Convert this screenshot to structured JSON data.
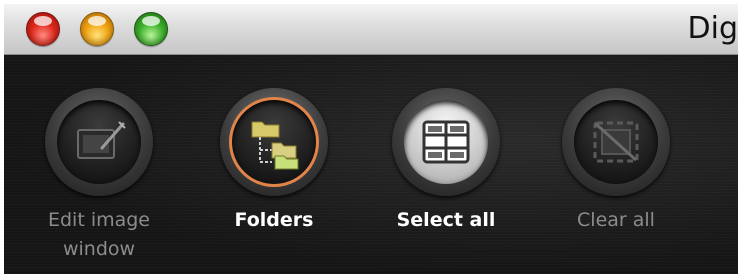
{
  "window": {
    "title": "Dig",
    "traffic_lights": [
      "close",
      "minimize",
      "zoom"
    ]
  },
  "toolbar": {
    "items": [
      {
        "label": "Edit image window",
        "icon": "edit-image-icon",
        "enabled": false
      },
      {
        "label": "Folders",
        "icon": "folders-icon",
        "enabled": true,
        "active": true
      },
      {
        "label": "Select all",
        "icon": "select-all-icon",
        "enabled": true
      },
      {
        "label": "Clear all",
        "icon": "clear-all-icon",
        "enabled": false
      }
    ]
  },
  "colors": {
    "active_ring": "#e0844a",
    "label_enabled": "#ffffff",
    "label_disabled": "#8c8c8c",
    "toolbar_bg": "#1b1b1b"
  }
}
